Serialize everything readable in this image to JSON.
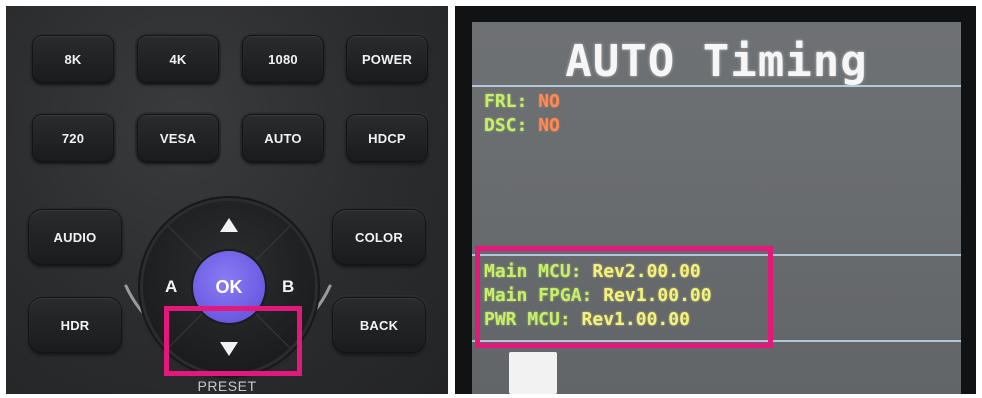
{
  "keypad": {
    "row1": [
      "8K",
      "4K",
      "1080",
      "POWER"
    ],
    "row2": [
      "720",
      "VESA",
      "AUTO",
      "HDCP"
    ],
    "side_left": [
      "AUDIO",
      "HDR"
    ],
    "side_right": [
      "COLOR",
      "BACK"
    ],
    "dpad": {
      "ok": "OK",
      "left": "A",
      "right": "B"
    },
    "preset_label": "PRESET",
    "highlight_color": "#e2197b"
  },
  "lcd": {
    "title": "AUTO Timing",
    "status": [
      {
        "label": "FRL:",
        "value": "NO"
      },
      {
        "label": "DSC:",
        "value": "NO"
      }
    ],
    "versions": [
      {
        "label": "Main MCU:",
        "value": "Rev2.00.00"
      },
      {
        "label": "Main FPGA:",
        "value": "Rev1.00.00"
      },
      {
        "label": "PWR MCU:",
        "value": "Rev1.00.00"
      }
    ],
    "label_color": "#c6f067",
    "status_value_color": "#ff8a52",
    "version_color": "#f4f27a"
  }
}
